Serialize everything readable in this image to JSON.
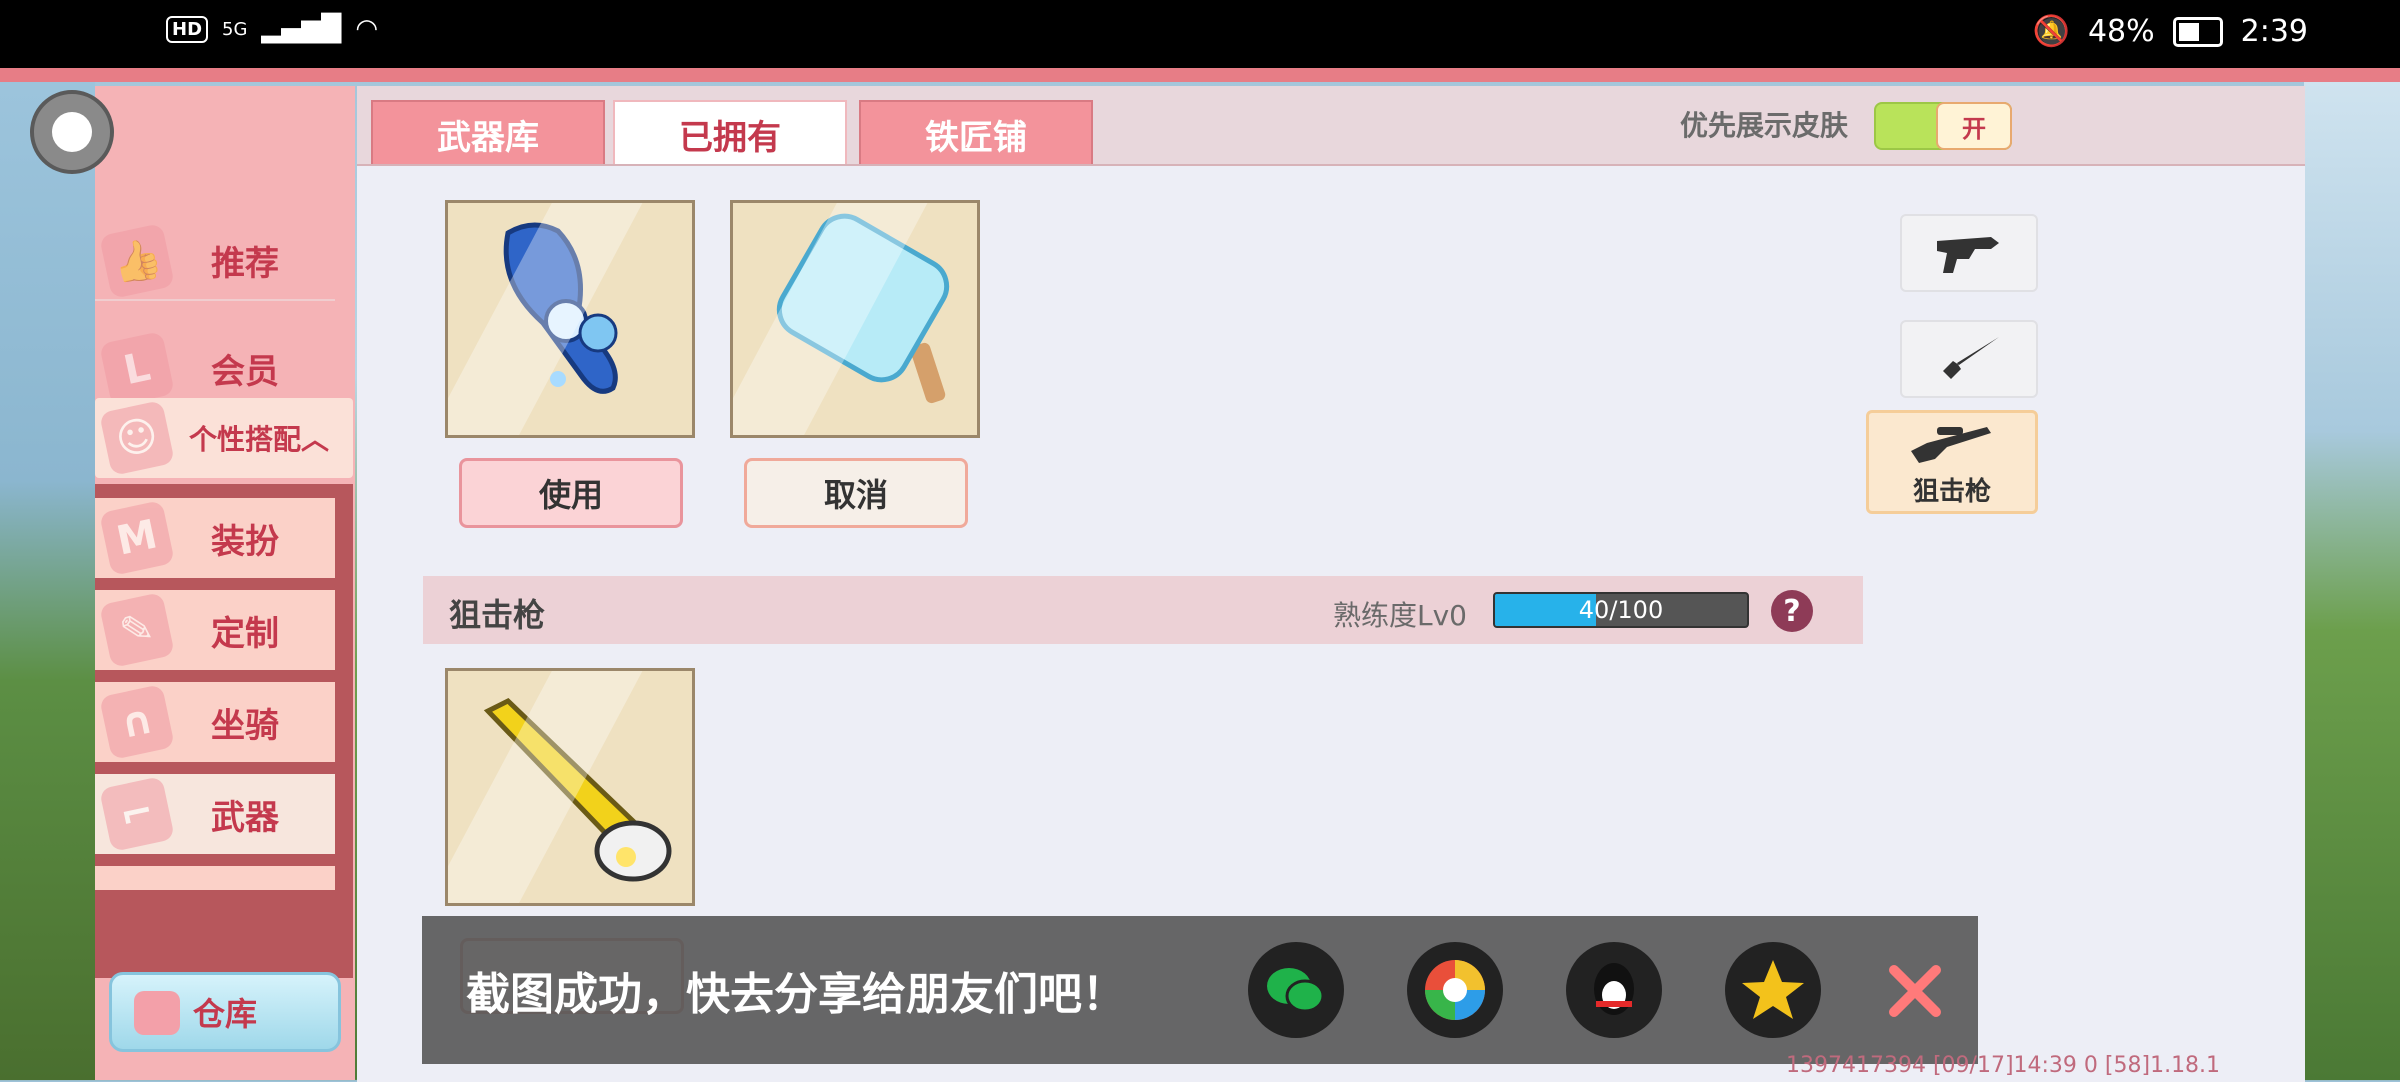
{
  "status_bar": {
    "network": "5G",
    "hd": "HD",
    "battery_pct": "48%",
    "time": "2:39"
  },
  "tabs": [
    {
      "label": "武器库"
    },
    {
      "label": "已拥有"
    },
    {
      "label": "铁匠铺"
    }
  ],
  "skin_toggle": {
    "label": "优先展示皮肤",
    "state": "开"
  },
  "sidebar": {
    "items": [
      {
        "label": "推荐"
      },
      {
        "label": "会员"
      },
      {
        "label": "个性搭配︿"
      },
      {
        "label": "装扮"
      },
      {
        "label": "定制"
      },
      {
        "label": "坐骑"
      },
      {
        "label": "武器"
      }
    ],
    "warehouse": "仓库"
  },
  "weapons": {
    "top_buttons": [
      "使用",
      "取消"
    ],
    "section": {
      "title": "狙击枪",
      "proficiency_label": "熟练度Lv0",
      "progress_text": "40/100",
      "progress_fraction": 0.4,
      "help": "?"
    }
  },
  "categories": [
    {
      "icon": "revolver-icon"
    },
    {
      "icon": "knife-icon"
    },
    {
      "icon": "sniper-rifle-icon",
      "label": "狙击枪"
    }
  ],
  "toast": {
    "message": "截图成功，快去分享给朋友们吧！",
    "targets": [
      "wechat-icon",
      "moments-icon",
      "qq-icon",
      "qzone-icon"
    ]
  },
  "footer": {
    "info": "1397417394    [09/17]14:39 0   [58]1.18.1"
  }
}
